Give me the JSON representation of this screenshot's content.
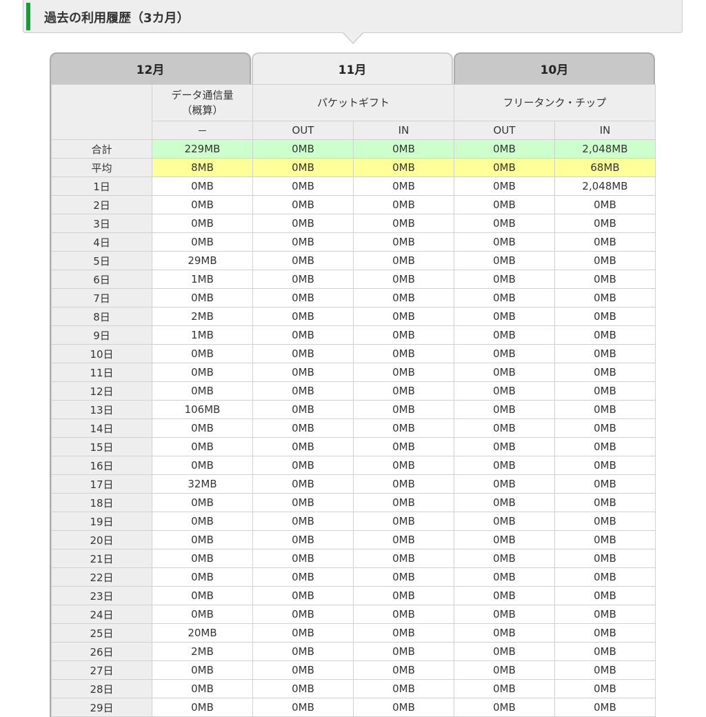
{
  "section": {
    "title": "過去の利用履歴（3カ月）"
  },
  "tabs": [
    {
      "label": "12月",
      "active": false
    },
    {
      "label": "11月",
      "active": true
    },
    {
      "label": "10月",
      "active": false
    }
  ],
  "columns": {
    "data": {
      "label_line1": "データ通信量",
      "label_line2": "（概算）",
      "sub": "－"
    },
    "packet_gift": {
      "label": "パケットギフト",
      "out": "OUT",
      "in": "IN"
    },
    "free_tank": {
      "label": "フリータンク・チップ",
      "out": "OUT",
      "in": "IN"
    }
  },
  "colors": {
    "total_row": "#ccffcc",
    "avg_row": "#ffff99",
    "accent": "#1a9b3a"
  },
  "rows": [
    {
      "label": "合計",
      "values": [
        "229MB",
        "0MB",
        "0MB",
        "0MB",
        "2,048MB"
      ]
    },
    {
      "label": "平均",
      "values": [
        "8MB",
        "0MB",
        "0MB",
        "0MB",
        "68MB"
      ]
    },
    {
      "label": "1日",
      "values": [
        "0MB",
        "0MB",
        "0MB",
        "0MB",
        "2,048MB"
      ]
    },
    {
      "label": "2日",
      "values": [
        "0MB",
        "0MB",
        "0MB",
        "0MB",
        "0MB"
      ]
    },
    {
      "label": "3日",
      "values": [
        "0MB",
        "0MB",
        "0MB",
        "0MB",
        "0MB"
      ]
    },
    {
      "label": "4日",
      "values": [
        "0MB",
        "0MB",
        "0MB",
        "0MB",
        "0MB"
      ]
    },
    {
      "label": "5日",
      "values": [
        "29MB",
        "0MB",
        "0MB",
        "0MB",
        "0MB"
      ]
    },
    {
      "label": "6日",
      "values": [
        "1MB",
        "0MB",
        "0MB",
        "0MB",
        "0MB"
      ]
    },
    {
      "label": "7日",
      "values": [
        "0MB",
        "0MB",
        "0MB",
        "0MB",
        "0MB"
      ]
    },
    {
      "label": "8日",
      "values": [
        "2MB",
        "0MB",
        "0MB",
        "0MB",
        "0MB"
      ]
    },
    {
      "label": "9日",
      "values": [
        "1MB",
        "0MB",
        "0MB",
        "0MB",
        "0MB"
      ]
    },
    {
      "label": "10日",
      "values": [
        "0MB",
        "0MB",
        "0MB",
        "0MB",
        "0MB"
      ]
    },
    {
      "label": "11日",
      "values": [
        "0MB",
        "0MB",
        "0MB",
        "0MB",
        "0MB"
      ]
    },
    {
      "label": "12日",
      "values": [
        "0MB",
        "0MB",
        "0MB",
        "0MB",
        "0MB"
      ]
    },
    {
      "label": "13日",
      "values": [
        "106MB",
        "0MB",
        "0MB",
        "0MB",
        "0MB"
      ]
    },
    {
      "label": "14日",
      "values": [
        "0MB",
        "0MB",
        "0MB",
        "0MB",
        "0MB"
      ]
    },
    {
      "label": "15日",
      "values": [
        "0MB",
        "0MB",
        "0MB",
        "0MB",
        "0MB"
      ]
    },
    {
      "label": "16日",
      "values": [
        "0MB",
        "0MB",
        "0MB",
        "0MB",
        "0MB"
      ]
    },
    {
      "label": "17日",
      "values": [
        "32MB",
        "0MB",
        "0MB",
        "0MB",
        "0MB"
      ]
    },
    {
      "label": "18日",
      "values": [
        "0MB",
        "0MB",
        "0MB",
        "0MB",
        "0MB"
      ]
    },
    {
      "label": "19日",
      "values": [
        "0MB",
        "0MB",
        "0MB",
        "0MB",
        "0MB"
      ]
    },
    {
      "label": "20日",
      "values": [
        "0MB",
        "0MB",
        "0MB",
        "0MB",
        "0MB"
      ]
    },
    {
      "label": "21日",
      "values": [
        "0MB",
        "0MB",
        "0MB",
        "0MB",
        "0MB"
      ]
    },
    {
      "label": "22日",
      "values": [
        "0MB",
        "0MB",
        "0MB",
        "0MB",
        "0MB"
      ]
    },
    {
      "label": "23日",
      "values": [
        "0MB",
        "0MB",
        "0MB",
        "0MB",
        "0MB"
      ]
    },
    {
      "label": "24日",
      "values": [
        "0MB",
        "0MB",
        "0MB",
        "0MB",
        "0MB"
      ]
    },
    {
      "label": "25日",
      "values": [
        "20MB",
        "0MB",
        "0MB",
        "0MB",
        "0MB"
      ]
    },
    {
      "label": "26日",
      "values": [
        "2MB",
        "0MB",
        "0MB",
        "0MB",
        "0MB"
      ]
    },
    {
      "label": "27日",
      "values": [
        "0MB",
        "0MB",
        "0MB",
        "0MB",
        "0MB"
      ]
    },
    {
      "label": "28日",
      "values": [
        "0MB",
        "0MB",
        "0MB",
        "0MB",
        "0MB"
      ]
    },
    {
      "label": "29日",
      "values": [
        "0MB",
        "0MB",
        "0MB",
        "0MB",
        "0MB"
      ]
    }
  ]
}
